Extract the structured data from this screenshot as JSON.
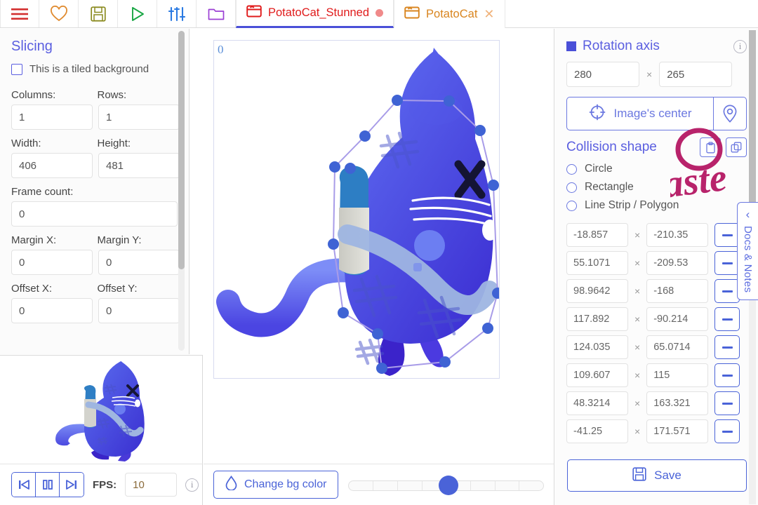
{
  "toolbar": {
    "icons": [
      {
        "name": "menu-icon",
        "glyph": "hamburger",
        "color": "#d32f2f"
      },
      {
        "name": "heart-icon",
        "glyph": "heart",
        "color": "#e08a2e"
      },
      {
        "name": "save-icon",
        "glyph": "floppy",
        "color": "#8a8a1e"
      },
      {
        "name": "play-icon",
        "glyph": "triangle",
        "color": "#19a644"
      },
      {
        "name": "settings-sliders-icon",
        "glyph": "sliders",
        "color": "#2a7ae2"
      },
      {
        "name": "open-folder-icon",
        "glyph": "folder",
        "color": "#9b3fd4"
      }
    ]
  },
  "tabs": [
    {
      "label": "PotatoCat_Stunned",
      "active": true,
      "dirty": true,
      "icon_color": "#e01b1b",
      "label_color": "#e01b1b"
    },
    {
      "label": "PotatoCat",
      "active": false,
      "dirty": false,
      "icon_color": "#d9851f",
      "label_color": "#d9851f"
    }
  ],
  "left_panel": {
    "section_title": "Slicing",
    "tiled_checkbox": {
      "label": "This is a tiled background",
      "checked": false
    },
    "fields": [
      {
        "label": "Columns:",
        "value": "1"
      },
      {
        "label": "Rows:",
        "value": "1"
      },
      {
        "label": "Width:",
        "value": "406"
      },
      {
        "label": "Height:",
        "value": "481"
      }
    ],
    "frame_count": {
      "label": "Frame count:",
      "value": "0"
    },
    "margin": [
      {
        "label": "Margin X:",
        "value": "0"
      },
      {
        "label": "Margin Y:",
        "value": "0"
      }
    ],
    "offset": [
      {
        "label": "Offset X:",
        "value": "0"
      },
      {
        "label": "Offset Y:",
        "value": "0"
      }
    ]
  },
  "transport": {
    "buttons": [
      "skip-start",
      "pause",
      "skip-end"
    ],
    "fps_label": "FPS:",
    "fps_value": "10"
  },
  "canvas": {
    "frame_index": "0"
  },
  "bottom_bar": {
    "bg_button_label": "Change bg color",
    "timeline_cells": 8,
    "timeline_position_pct": 48
  },
  "right_panel": {
    "rotation": {
      "title": "Rotation axis",
      "swatch_color": "#4a50d8",
      "x": "280",
      "y": "265",
      "separator": "×",
      "center_button_label": "Image's center"
    },
    "collision": {
      "title": "Collision shape",
      "options": [
        {
          "label": "Circle",
          "selected": false
        },
        {
          "label": "Rectangle",
          "selected": false
        },
        {
          "label": "Line Strip / Polygon",
          "selected": false
        }
      ],
      "points": [
        {
          "x": "-18.857",
          "y": "-210.35"
        },
        {
          "x": "55.1071",
          "y": "-209.53"
        },
        {
          "x": "98.9642",
          "y": "-168"
        },
        {
          "x": "117.892",
          "y": "-90.214"
        },
        {
          "x": "124.035",
          "y": "65.0714"
        },
        {
          "x": "109.607",
          "y": "115"
        },
        {
          "x": "48.3214",
          "y": "163.321"
        },
        {
          "x": "-41.25",
          "y": "171.571"
        }
      ]
    },
    "save_label": "Save"
  },
  "docs_tab": {
    "label": "Docs & Notes",
    "chevron": "‹"
  },
  "annotations": [
    {
      "name": "paste-handwriting",
      "text": "paste",
      "color": "#b8236b"
    },
    {
      "name": "paste-circle-highlight",
      "color": "#b8236b"
    }
  ],
  "colors": {
    "accent_blue": "#4a63d8",
    "title_purple": "#5b5fe0",
    "annotation_magenta": "#b8236b",
    "active_tab_red": "#e01b1b"
  }
}
